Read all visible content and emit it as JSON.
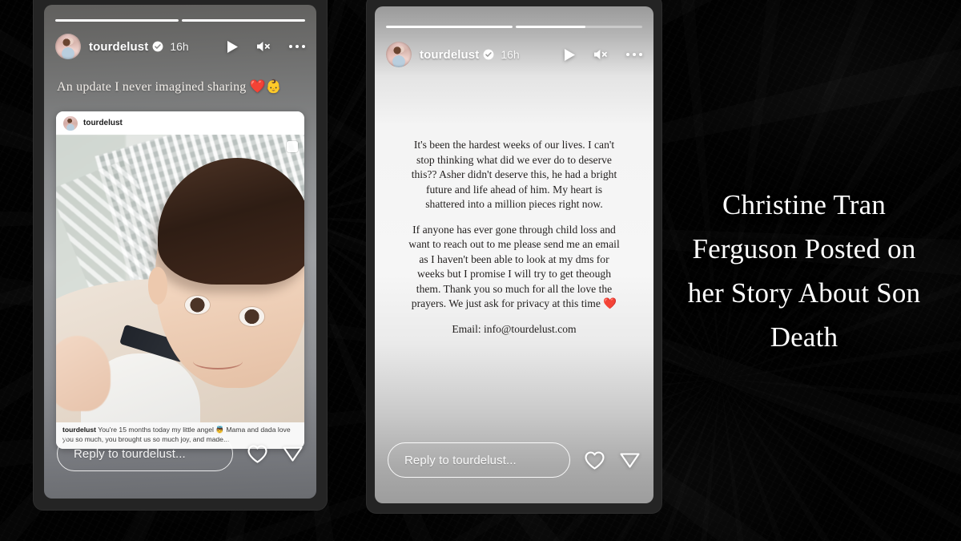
{
  "background": {
    "color": "#010101",
    "style": "dark grunge texture"
  },
  "headline": {
    "text": "Christine Tran Ferguson Posted on her Story About Son Death",
    "color": "#ffffff"
  },
  "stories": [
    {
      "id": "left",
      "progress": {
        "segments": 2,
        "fill": [
          100,
          100
        ]
      },
      "header": {
        "username": "tourdelust",
        "verified_icon": "verified-badge-icon",
        "timestamp": "16h",
        "play_icon": "play-icon",
        "mute_icon": "mute-speaker-icon",
        "more_icon": "more-options-icon"
      },
      "caption": "An update I never imagined sharing ❤️👶",
      "embedded_post": {
        "username": "tourdelust",
        "photo_alt": "baby with dark hair in cream outfit",
        "caption_author": "tourdelust",
        "caption_text": " You're 15 months today my little angel 👼 Mama and dada love you so much, you brought us so much joy, and made..."
      },
      "reply": {
        "placeholder": "Reply to tourdelust...",
        "like_icon": "heart-icon",
        "share_icon": "send-icon"
      }
    },
    {
      "id": "right",
      "progress": {
        "segments": 2,
        "fill": [
          100,
          55
        ]
      },
      "header": {
        "username": "tourdelust",
        "verified_icon": "verified-badge-icon",
        "timestamp": "16h",
        "play_icon": "play-icon",
        "mute_icon": "mute-speaker-icon",
        "more_icon": "more-options-icon"
      },
      "message": {
        "paragraph_1": "It's been the hardest weeks of our lives. I can't stop thinking what did we ever do to deserve this?? Asher didn't deserve this, he had a bright future and life ahead of him. My heart is shattered into a million pieces right now.",
        "paragraph_2": "If anyone has ever gone through child loss and want to reach out to me please send me an email as I haven't been able to look at my dms for weeks but I promise I will try to get theough them. Thank you so much for all the love the prayers. We just ask for privacy at this time ❤️",
        "email": "Email: info@tourdelust.com"
      },
      "reply": {
        "placeholder": "Reply to tourdelust...",
        "like_icon": "heart-icon",
        "share_icon": "send-icon"
      }
    }
  ]
}
